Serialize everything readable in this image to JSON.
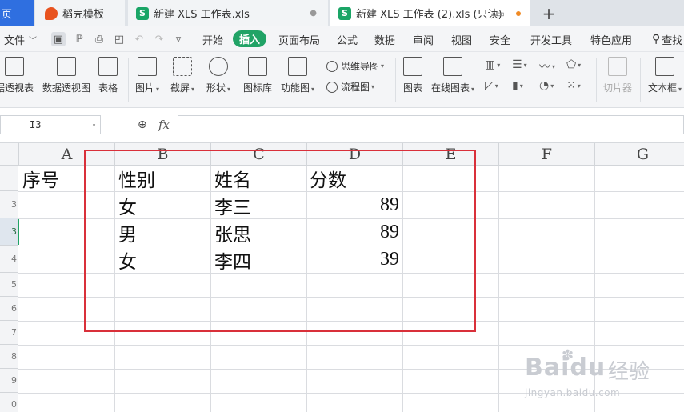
{
  "tabs": {
    "home": "页",
    "template": "稻壳模板",
    "file1": "新建 XLS 工作表.xls",
    "file2": "新建 XLS 工作表 (2).xls (只读)",
    "add": "+"
  },
  "menu": {
    "file": "文件",
    "items": [
      "开始",
      "插入",
      "页面布局",
      "公式",
      "数据",
      "审阅",
      "视图",
      "安全",
      "开发工具",
      "特色应用"
    ],
    "active_index": 1,
    "search": "查找"
  },
  "ribbon": {
    "pivot_table": "据透视表",
    "pivot_chart": "数据透视图",
    "table": "表格",
    "picture": "图片",
    "screenshot": "截屏",
    "shape": "形状",
    "icon_lib": "图标库",
    "func_chart": "功能图",
    "mindmap": "思维导图",
    "flowchart": "流程图",
    "chart": "图表",
    "online_chart": "在线图表",
    "slicer": "切片器",
    "textbox": "文本框"
  },
  "formula_bar": {
    "cell_ref": "I3",
    "fx": "fx",
    "value": ""
  },
  "sheet": {
    "columns": [
      "A",
      "B",
      "C",
      "D",
      "E",
      "F",
      "G"
    ],
    "row_numbers": [
      "",
      "3",
      "3",
      "4",
      "5",
      "6",
      "7",
      "8",
      "9",
      "0"
    ],
    "header": [
      "序号",
      "性别",
      "姓名",
      "分数"
    ],
    "rows": [
      {
        "gender": "女",
        "name": "李三",
        "score": "89"
      },
      {
        "gender": "男",
        "name": "张思",
        "score": "89"
      },
      {
        "gender": "女",
        "name": "李四",
        "score": "39"
      }
    ]
  },
  "watermark": {
    "logo": "Baidu",
    "text": "经验",
    "url": "jingyan.baidu.com"
  },
  "colors": {
    "accent": "#21a366",
    "tab_blue": "#2f6fe0",
    "highlight_box": "#d9303a"
  }
}
